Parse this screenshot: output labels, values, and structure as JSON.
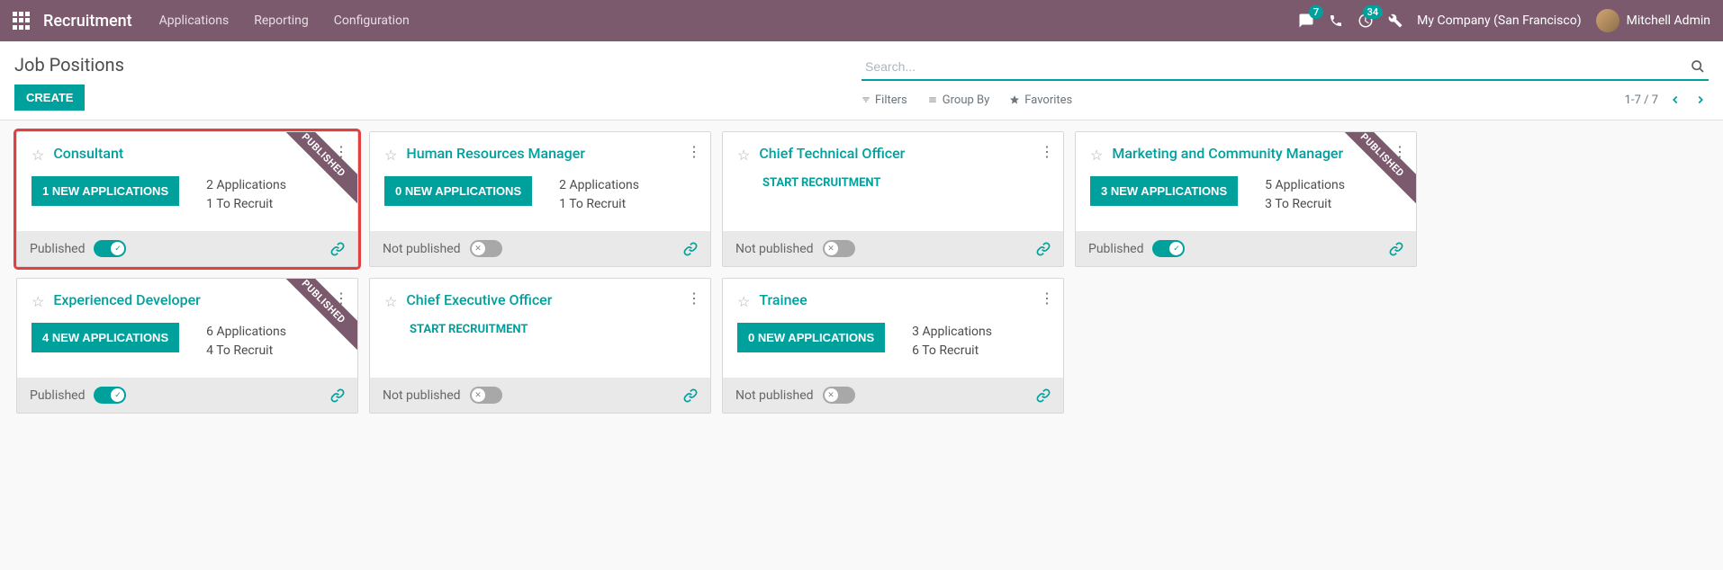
{
  "nav": {
    "brand": "Recruitment",
    "links": [
      "Applications",
      "Reporting",
      "Configuration"
    ],
    "msg_badge": "7",
    "activity_badge": "34",
    "company": "My Company (San Francisco)",
    "user": "Mitchell Admin"
  },
  "cp": {
    "title": "Job Positions",
    "create": "CREATE",
    "search_placeholder": "Search...",
    "filters": "Filters",
    "groupby": "Group By",
    "favorites": "Favorites",
    "pager": "1-7 / 7"
  },
  "ribbon_label": "PUBLISHED",
  "cards": [
    {
      "title": "Consultant",
      "apps_btn": "1 NEW APPLICATIONS",
      "line1": "2 Applications",
      "line2": "1 To Recruit",
      "published": true,
      "pub_label": "Published",
      "ribbon": true,
      "highlighted": true
    },
    {
      "title": "Human Resources Manager",
      "apps_btn": "0 NEW APPLICATIONS",
      "line1": "2 Applications",
      "line2": "1 To Recruit",
      "published": false,
      "pub_label": "Not published",
      "ribbon": false
    },
    {
      "title": "Chief Technical Officer",
      "start_recruit": "START RECRUITMENT",
      "published": false,
      "pub_label": "Not published",
      "ribbon": false
    },
    {
      "title": "Marketing and Community Manager",
      "apps_btn": "3 NEW APPLICATIONS",
      "line1": "5 Applications",
      "line2": "3 To Recruit",
      "published": true,
      "pub_label": "Published",
      "ribbon": true
    },
    {
      "title": "Experienced Developer",
      "apps_btn": "4 NEW APPLICATIONS",
      "line1": "6 Applications",
      "line2": "4 To Recruit",
      "published": true,
      "pub_label": "Published",
      "ribbon": true
    },
    {
      "title": "Chief Executive Officer",
      "start_recruit": "START RECRUITMENT",
      "published": false,
      "pub_label": "Not published",
      "ribbon": false
    },
    {
      "title": "Trainee",
      "apps_btn": "0 NEW APPLICATIONS",
      "line1": "3 Applications",
      "line2": "6 To Recruit",
      "published": false,
      "pub_label": "Not published",
      "ribbon": false
    }
  ]
}
